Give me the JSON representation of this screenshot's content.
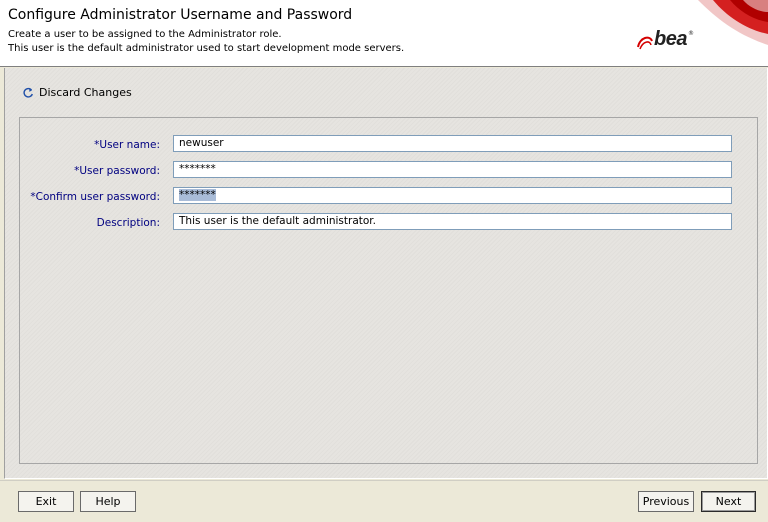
{
  "header": {
    "title": "Configure Administrator Username and Password",
    "line1": "Create a user to be assigned to the Administrator role.",
    "line2": "This user is the default administrator used to start development mode servers.",
    "logo_text": "bea",
    "logo_mark": "®"
  },
  "toolbar": {
    "discard_label": "Discard Changes"
  },
  "form": {
    "username_label": "*User name:",
    "username_value": "newuser",
    "password_label": "*User password:",
    "password_value": "*******",
    "confirm_label": "*Confirm user password:",
    "confirm_value": "*******",
    "description_label": "Description:",
    "description_value": "This user is the default administrator."
  },
  "footer": {
    "exit_label": "Exit",
    "help_label": "Help",
    "previous_label": "Previous",
    "next_label": "Next"
  },
  "colors": {
    "label": "#000080",
    "selection": "#a9bcd8",
    "brand_red": "#d40000"
  },
  "icons": {
    "discard": "refresh-icon",
    "logo": "bea-logo"
  }
}
